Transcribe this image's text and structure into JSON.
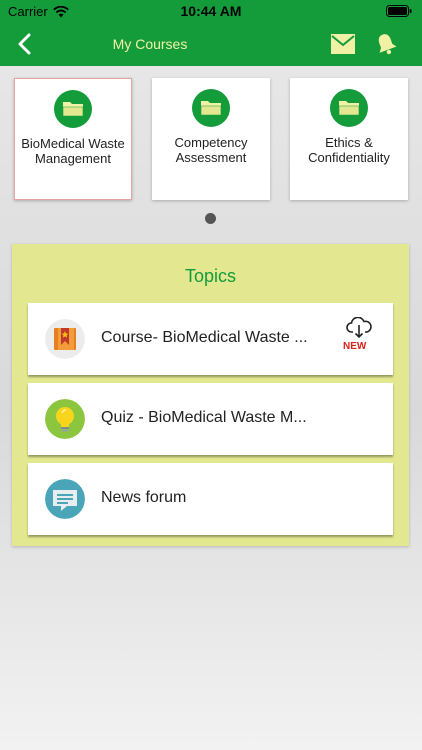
{
  "status_bar": {
    "carrier": "Carrier",
    "time": "10:44 AM"
  },
  "nav": {
    "title": "My Courses"
  },
  "courses": [
    {
      "label": "BioMedical Waste Management",
      "selected": true
    },
    {
      "label": "Competency Assessment",
      "selected": false
    },
    {
      "label": "Ethics & Confidentiality",
      "selected": false
    }
  ],
  "topics": {
    "title": "Topics",
    "items": [
      {
        "label": "Course- BioMedical Waste ...",
        "icon": "book-bookmark-icon",
        "new_badge": "NEW"
      },
      {
        "label": "Quiz - BioMedical Waste M...",
        "icon": "lightbulb-icon"
      },
      {
        "label": "News forum",
        "icon": "chat-bubble-icon"
      }
    ]
  },
  "colors": {
    "primary_green": "#149c3b",
    "panel_yellow": "#e3e890",
    "nav_title": "#f1f1a6",
    "badge_red": "#d9241c"
  }
}
